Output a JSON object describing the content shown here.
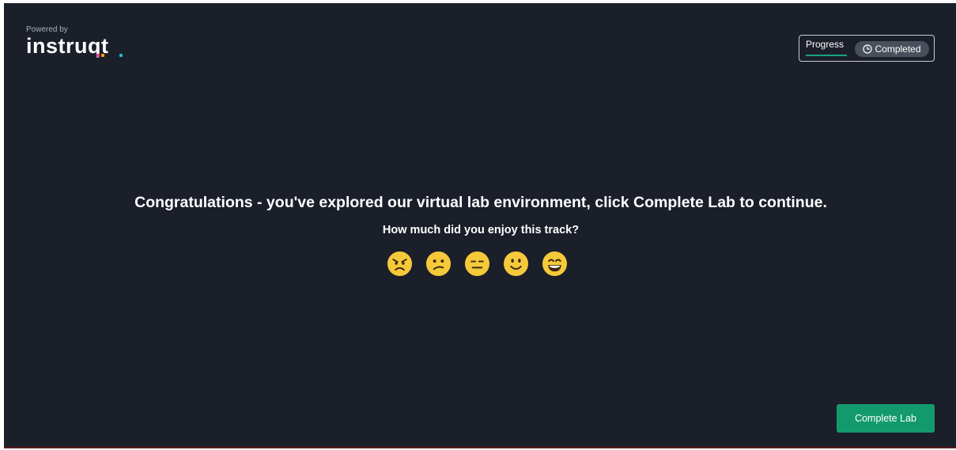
{
  "brand": {
    "powered_by": "Powered by",
    "logo_text": "instruqt",
    "accent_colors": [
      "#e84393",
      "#f2a400",
      "#19c2d6"
    ]
  },
  "progress": {
    "tab_label": "Progress",
    "status_label": "Completed",
    "status_icon": "clock-icon"
  },
  "main": {
    "headline": "Congratulations - you've explored our virtual lab environment, click Complete Lab to continue.",
    "question": "How much did you enjoy this track?",
    "ratings": [
      {
        "icon": "angry-face-icon"
      },
      {
        "icon": "confused-face-icon"
      },
      {
        "icon": "neutral-face-icon"
      },
      {
        "icon": "smiling-face-icon"
      },
      {
        "icon": "grinning-face-icon"
      }
    ]
  },
  "footer": {
    "complete_button": "Complete Lab"
  },
  "colors": {
    "background": "#1b1f2a",
    "accent": "#139a6c",
    "emoji": "#f6c93a"
  }
}
